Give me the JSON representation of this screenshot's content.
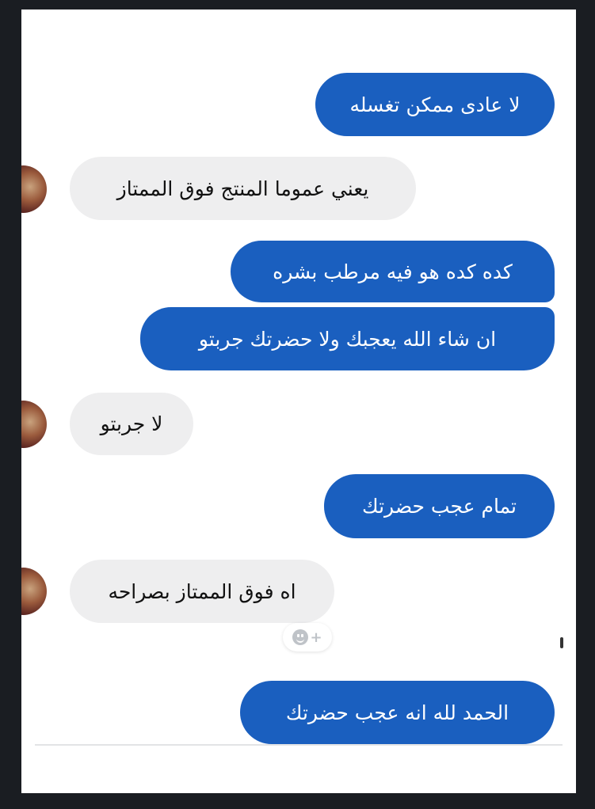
{
  "messages": [
    {
      "direction": "outgoing",
      "text": "لا عادى ممكن تغسله"
    },
    {
      "direction": "incoming",
      "text": "يعني عموما المنتج فوق الممتاز"
    },
    {
      "direction": "outgoing",
      "text": "كده كده هو فيه مرطب بشره"
    },
    {
      "direction": "outgoing",
      "text": "ان شاء الله يعجبك ولا حضرتك جربتو"
    },
    {
      "direction": "incoming",
      "text": "لا جربتو"
    },
    {
      "direction": "outgoing",
      "text": "تمام عجب حضرتك"
    },
    {
      "direction": "incoming",
      "text": "اه فوق الممتاز بصراحه"
    },
    {
      "direction": "outgoing",
      "text": "الحمد لله انه عجب حضرتك"
    }
  ],
  "reaction_button": {
    "icon": "smiley-plus-icon",
    "symbol": "+"
  },
  "colors": {
    "outgoing_bubble": "#1a5fbf",
    "incoming_bubble": "#eeeeef",
    "background": "#ffffff",
    "frame": "#1a1d22"
  }
}
